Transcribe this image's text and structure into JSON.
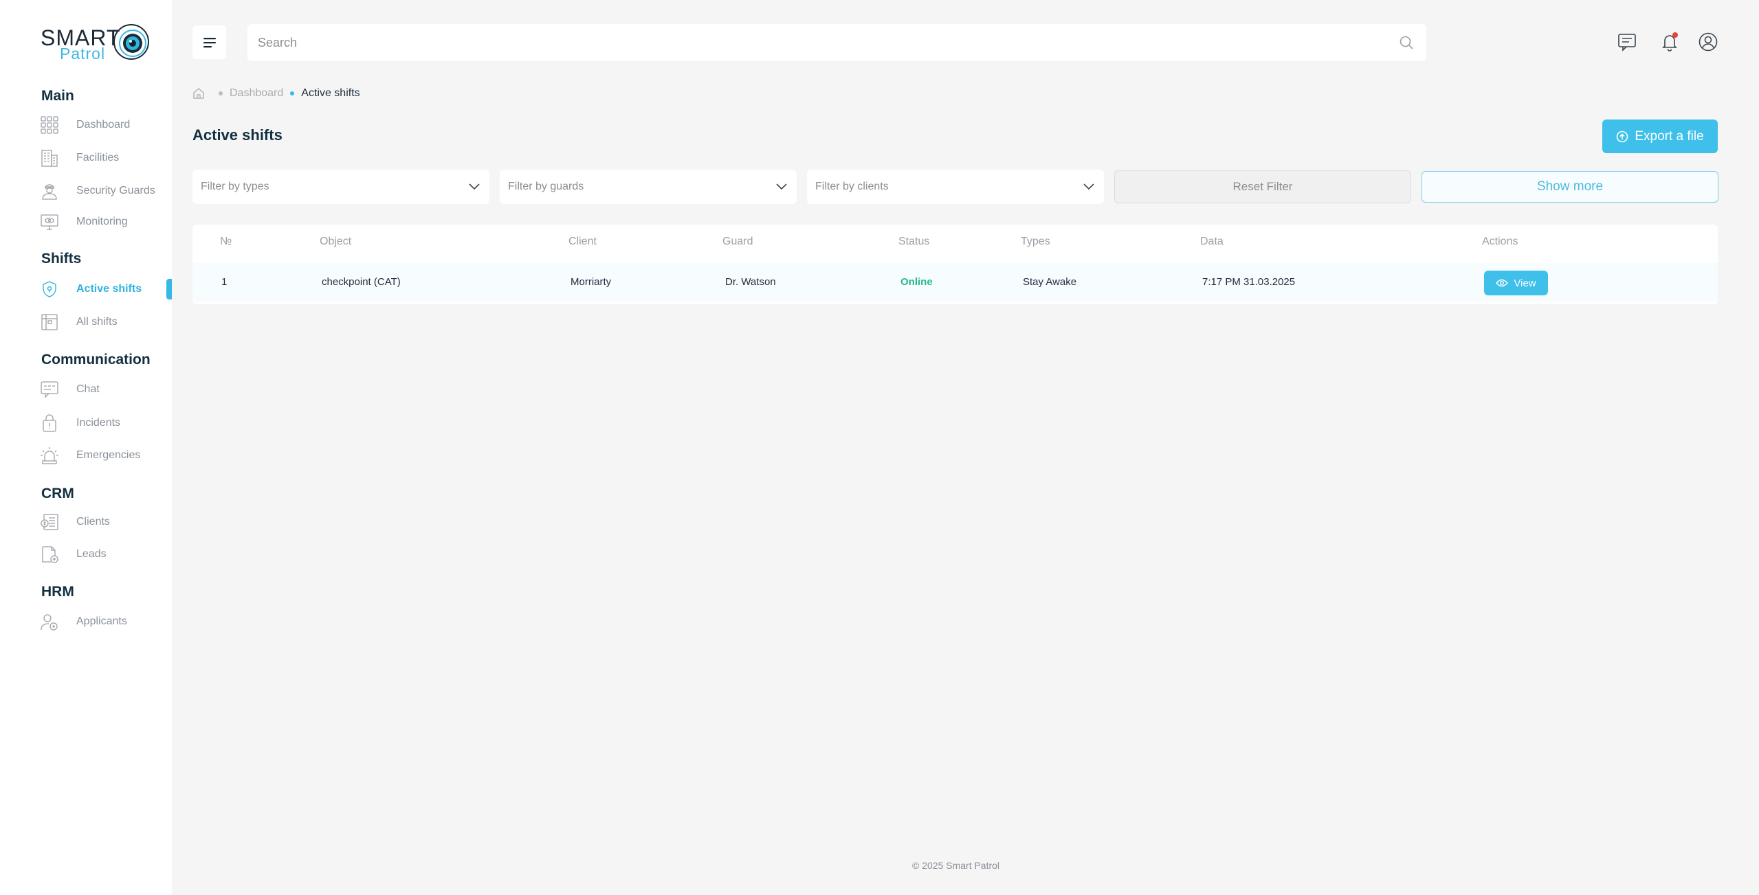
{
  "brand": {
    "name_top": "SMART",
    "name_bottom": "Patrol"
  },
  "sidebar": {
    "sections": [
      {
        "title": "Main"
      },
      {
        "title": "Shifts"
      },
      {
        "title": "Communication"
      },
      {
        "title": "CRM"
      },
      {
        "title": "HRM"
      }
    ],
    "items": [
      {
        "label": "Dashboard",
        "icon": "grid-icon"
      },
      {
        "label": "Facilities",
        "icon": "building-icon"
      },
      {
        "label": "Security Guards",
        "icon": "guard-icon"
      },
      {
        "label": "Monitoring",
        "icon": "monitor-icon"
      },
      {
        "label": "Active shifts",
        "icon": "shield-icon",
        "active": true
      },
      {
        "label": "All shifts",
        "icon": "calendar-icon"
      },
      {
        "label": "Chat",
        "icon": "chat-icon"
      },
      {
        "label": "Incidents",
        "icon": "incident-icon"
      },
      {
        "label": "Emergencies",
        "icon": "siren-icon"
      },
      {
        "label": "Clients",
        "icon": "clients-icon"
      },
      {
        "label": "Leads",
        "icon": "leads-icon"
      },
      {
        "label": "Applicants",
        "icon": "applicant-icon"
      }
    ]
  },
  "search": {
    "placeholder": "Search"
  },
  "breadcrumb": {
    "link": "Dashboard",
    "current": "Active shifts"
  },
  "page": {
    "title": "Active shifts",
    "export_label": "Export a file"
  },
  "filters": {
    "types_placeholder": "Filter by types",
    "guards_placeholder": "Filter by guards",
    "clients_placeholder": "Filter by clients",
    "reset_label": "Reset Filter",
    "show_more_label": "Show more"
  },
  "table": {
    "columns": [
      "№",
      "Object",
      "Client",
      "Guard",
      "Status",
      "Types",
      "Data",
      "Actions"
    ],
    "rows": [
      {
        "num": "1",
        "object": "checkpoint (CAT)",
        "client": "Morriarty",
        "guard": "Dr. Watson",
        "status": "Online",
        "type": "Stay Awake",
        "data": "7:17 PM 31.03.2025",
        "action_label": "View"
      }
    ]
  },
  "footer": {
    "copyright": "© 2025 Smart Patrol"
  },
  "colors": {
    "accent": "#3ec0ea",
    "online": "#26b88a",
    "notification": "#e0463c"
  }
}
